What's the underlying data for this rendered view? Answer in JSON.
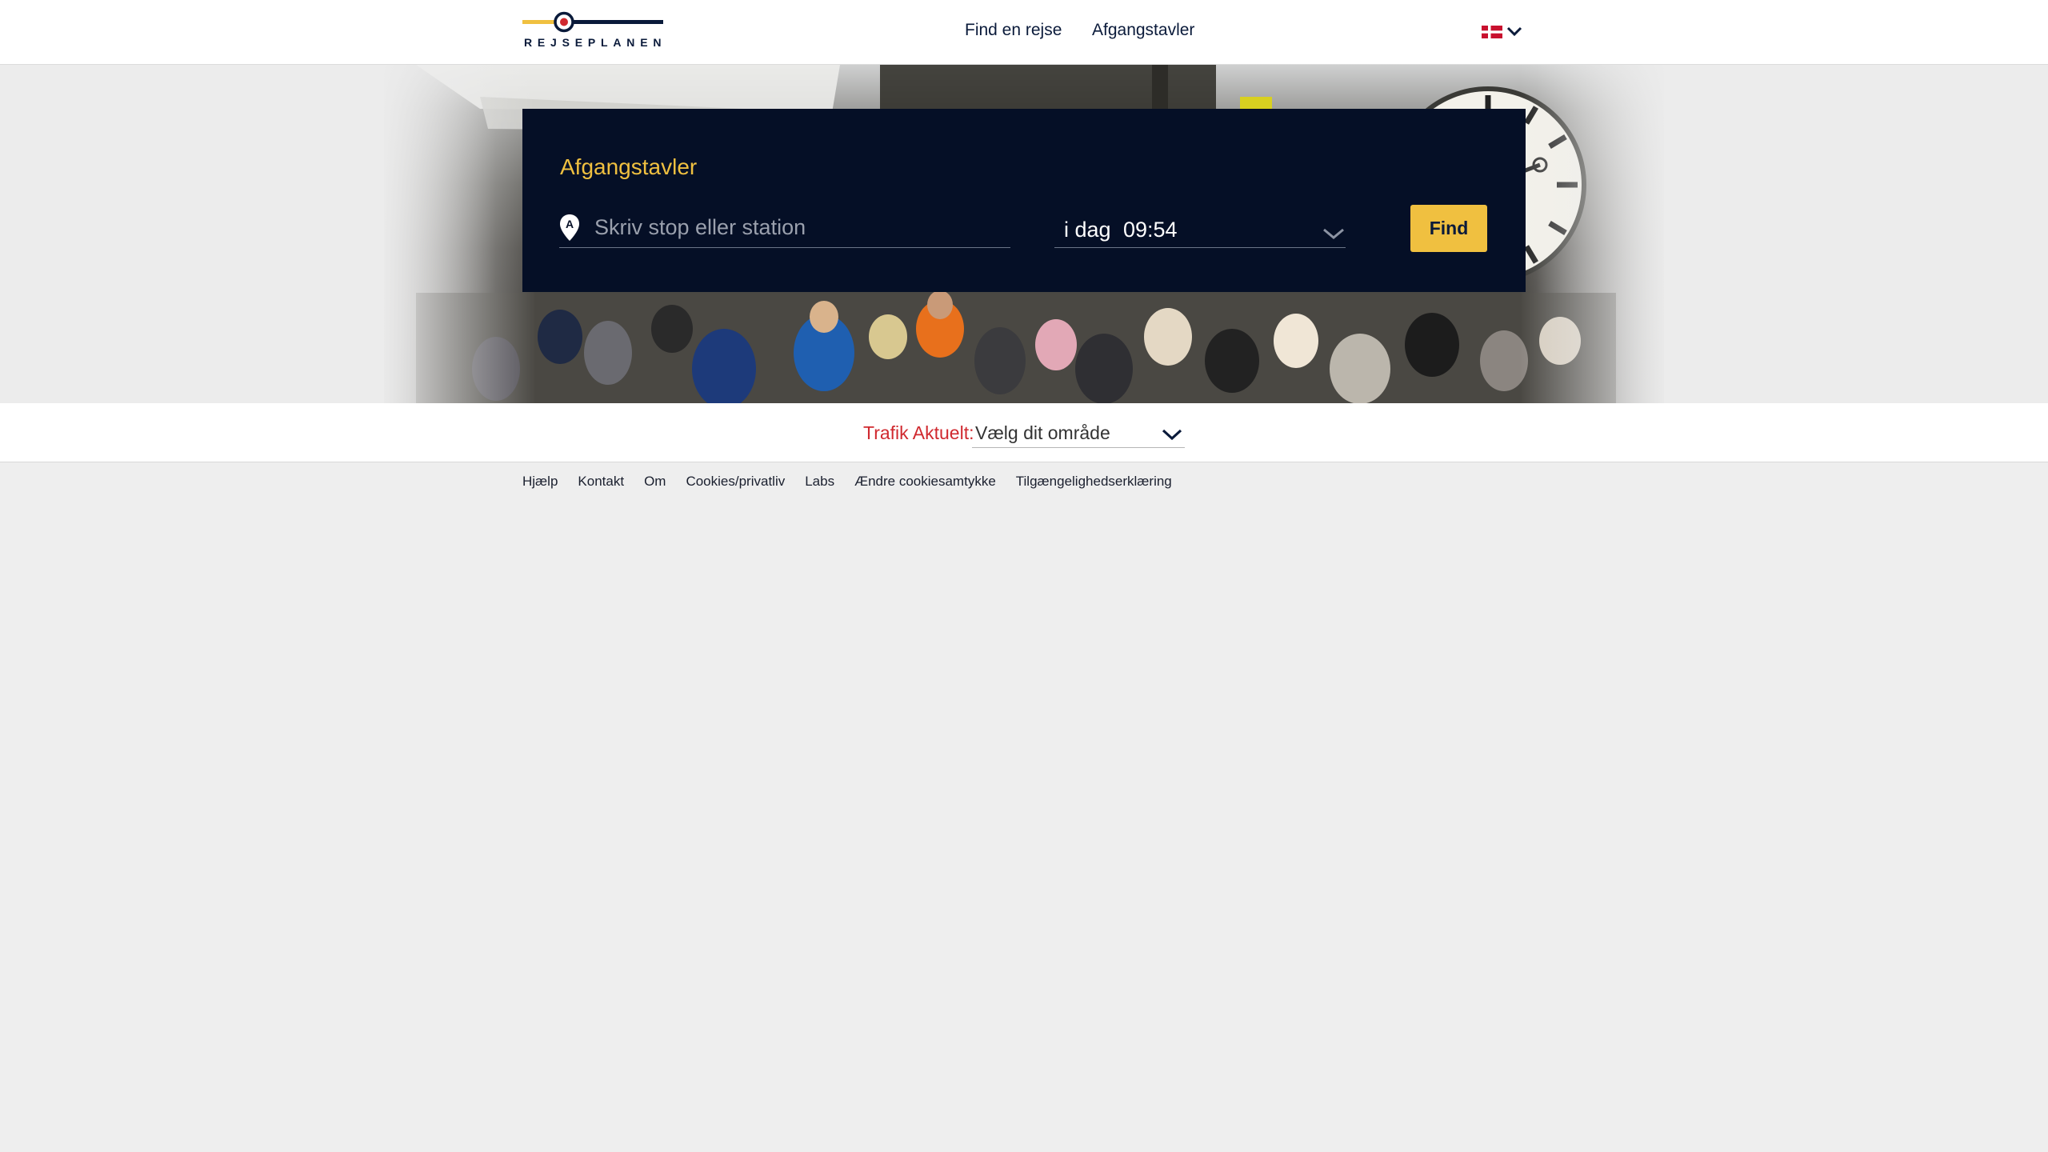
{
  "header": {
    "logo_text": "REJSEPLANEN",
    "nav": [
      {
        "label": "Find en rejse"
      },
      {
        "label": "Afgangstavler"
      }
    ],
    "language_icon": "danish-flag-icon"
  },
  "search": {
    "title": "Afgangstavler",
    "stop_placeholder": "Skriv stop eller station",
    "stop_value": "",
    "location_marker_letter": "A",
    "day": "i dag",
    "time": "09:54",
    "find_label": "Find"
  },
  "trafik": {
    "label": "Trafik Aktuelt:",
    "select_value": "Vælg dit område"
  },
  "footer": {
    "links": [
      "Hjælp",
      "Kontakt",
      "Om",
      "Cookies/privatliv",
      "Labs",
      "Ændre cookiesamtykke",
      "Tilgængelighedserklæring"
    ]
  },
  "colors": {
    "accent": "#f0c040",
    "panel": "#050f26",
    "navy": "#0a1a3a",
    "alert": "#d0292f",
    "danish_red": "#c8102e"
  }
}
